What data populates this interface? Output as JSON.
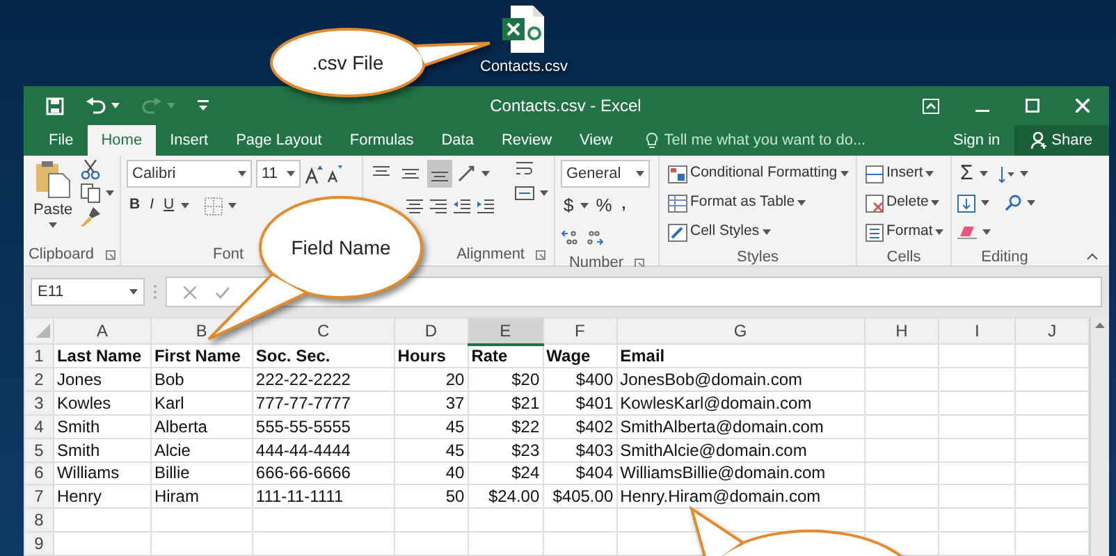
{
  "desktop_file": {
    "label": "Contacts.csv"
  },
  "callouts": [
    {
      "kind": "text",
      "text": ".csv File"
    },
    {
      "kind": "text",
      "text": "Field Name"
    },
    {
      "kind": "cut_off"
    }
  ],
  "window": {
    "title": "Contacts.csv - Excel"
  },
  "tabs": [
    {
      "label": "File",
      "selected": false
    },
    {
      "label": "Home",
      "selected": true
    },
    {
      "label": "Insert",
      "selected": false
    },
    {
      "label": "Page Layout",
      "selected": false
    },
    {
      "label": "Formulas",
      "selected": false
    },
    {
      "label": "Data",
      "selected": false
    },
    {
      "label": "Review",
      "selected": false
    },
    {
      "label": "View",
      "selected": false
    }
  ],
  "tell_me": {
    "placeholder": "Tell me what you want to do..."
  },
  "account": {
    "sign_in": "Sign in",
    "share": "Share"
  },
  "ribbon": {
    "clipboard": {
      "paste": "Paste",
      "label": "Clipboard"
    },
    "font": {
      "name": "Calibri",
      "size": "11",
      "bold": "B",
      "italic": "I",
      "underline": "U",
      "label": "Font"
    },
    "alignment": {
      "vertical_buttons": [
        {
          "kind": "top",
          "selected": false
        },
        {
          "kind": "middle",
          "selected": false
        },
        {
          "kind": "bottom",
          "selected": true
        }
      ],
      "label": "Alignment"
    },
    "number": {
      "format": "General",
      "currency": "$",
      "percent": "%",
      "comma": ",",
      "label": "Number"
    },
    "styles": {
      "items": [
        "Conditional Formatting",
        "Format as Table",
        "Cell Styles"
      ],
      "label": "Styles"
    },
    "cells": {
      "items": [
        "Insert",
        "Delete",
        "Format"
      ],
      "label": "Cells"
    },
    "editing": {
      "sum": "Σ",
      "label": "Editing"
    }
  },
  "formula_bar": {
    "name_box": "E11"
  },
  "sheet": {
    "columns": [
      {
        "label": "A",
        "selected": false,
        "numeric": false
      },
      {
        "label": "B",
        "selected": false,
        "numeric": false
      },
      {
        "label": "C",
        "selected": false,
        "numeric": false
      },
      {
        "label": "D",
        "selected": false,
        "numeric": true
      },
      {
        "label": "E",
        "selected": true,
        "numeric": true
      },
      {
        "label": "F",
        "selected": false,
        "numeric": true
      },
      {
        "label": "G",
        "selected": false,
        "numeric": false
      },
      {
        "label": "H",
        "selected": false
      },
      {
        "label": "I",
        "selected": false
      },
      {
        "label": "J",
        "selected": false
      }
    ],
    "rows": [
      {
        "number": "1",
        "kind": "header",
        "cells": [
          "Last Name",
          "First Name",
          "Soc. Sec.",
          "Hours",
          "Rate",
          "Wage",
          "Email"
        ]
      },
      {
        "number": "2",
        "kind": "data",
        "cells": [
          "Jones",
          "Bob",
          "222-22-2222",
          "20",
          "$20",
          "$400",
          "JonesBob@domain.com"
        ]
      },
      {
        "number": "3",
        "kind": "data",
        "cells": [
          "Kowles",
          "Karl",
          "777-77-7777",
          "37",
          "$21",
          "$401",
          "KowlesKarl@domain.com"
        ]
      },
      {
        "number": "4",
        "kind": "data",
        "cells": [
          "Smith",
          "Alberta",
          "555-55-5555",
          "45",
          "$22",
          "$402",
          "SmithAlberta@domain.com"
        ]
      },
      {
        "number": "5",
        "kind": "data",
        "cells": [
          "Smith",
          "Alcie",
          "444-44-4444",
          "45",
          "$23",
          "$403",
          "SmithAlcie@domain.com"
        ]
      },
      {
        "number": "6",
        "kind": "data",
        "cells": [
          "Williams",
          "Billie",
          "666-66-6666",
          "40",
          "$24",
          "$404",
          "WilliamsBillie@domain.com"
        ]
      },
      {
        "number": "7",
        "kind": "data",
        "cells": [
          "Henry",
          "Hiram",
          "111-11-1111",
          "50",
          "$24.00",
          "$405.00",
          "Henry.Hiram@domain.com"
        ]
      },
      {
        "number": "8",
        "kind": "empty"
      },
      {
        "number": "9",
        "kind": "empty"
      }
    ]
  }
}
